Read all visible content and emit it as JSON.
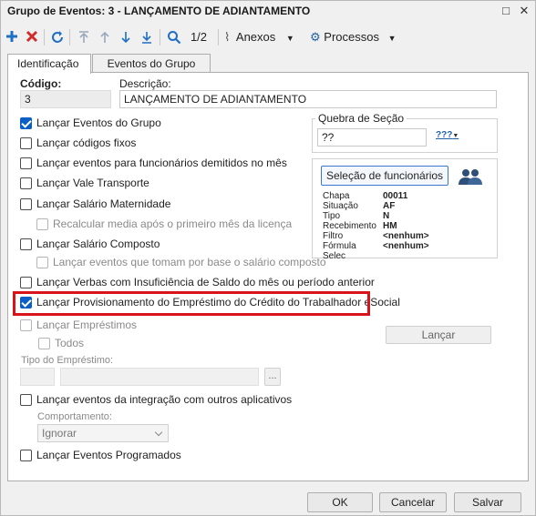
{
  "window": {
    "title": "Grupo de Eventos: 3 - LANÇAMENTO DE ADIANTAMENTO",
    "restore_glyph": "□",
    "close_glyph": "✕"
  },
  "toolbar": {
    "page_indicator": "1/2",
    "anexos_label": "Anexos",
    "processos_label": "Processos",
    "colors": {
      "add": "#1f6fc5",
      "delete": "#d12b2b",
      "refresh": "#1f6fc5",
      "nav": "#1f6fc5",
      "nav_disabled": "#9aa9bd"
    }
  },
  "tabs": [
    {
      "label": "Identificação"
    },
    {
      "label": "Eventos do Grupo"
    }
  ],
  "form": {
    "codigo_label": "Código:",
    "codigo_value": "3",
    "descricao_label": "Descrição:",
    "descricao_value": "LANÇAMENTO DE ADIANTAMENTO",
    "quebra_label": "Quebra de Seção",
    "quebra_value": "??",
    "quebra_picker_text": "???",
    "selecao_button": "Seleção de funcionários",
    "employee_fields": [
      {
        "key": "Chapa",
        "value": "00011"
      },
      {
        "key": "Situação",
        "value": "AF"
      },
      {
        "key": "Tipo",
        "value": "N"
      },
      {
        "key": "Recebimento",
        "value": "HM"
      },
      {
        "key": "Filtro",
        "value": "<nenhum>"
      },
      {
        "key": "Fórmula Selec",
        "value": "<nenhum>"
      }
    ],
    "checkboxes": [
      {
        "label": "Lançar Eventos do Grupo",
        "checked": true
      },
      {
        "label": "Lançar códigos fixos",
        "checked": false
      },
      {
        "label": "Lançar eventos para funcionários demitidos no mês",
        "checked": false
      },
      {
        "label": "Lançar Vale Transporte",
        "checked": false
      },
      {
        "label": "Lançar Salário Maternidade",
        "checked": false
      },
      {
        "label": "Recalcular media após o primeiro mês da licença",
        "checked": false,
        "disabled": true
      },
      {
        "label": "Lançar Salário Composto",
        "checked": false
      },
      {
        "label": "Lançar eventos que tomam por base o salário composto",
        "checked": false,
        "disabled": true
      },
      {
        "label": "Lançar Verbas com Insuficiência de Saldo do mês ou período anterior",
        "checked": false
      },
      {
        "label": "Lançar Provisionamento do Empréstimo do Crédito do Trabalhador eSocial",
        "checked": true
      },
      {
        "label": "Lançar Empréstimos",
        "checked": false,
        "disabled": true
      },
      {
        "label": "Todos",
        "checked": false,
        "disabled": true
      },
      {
        "label": "Lançar eventos da integração com outros aplicativos",
        "checked": false
      },
      {
        "label": "Lançar Eventos Programados",
        "checked": false
      }
    ],
    "lancar_button": "Lançar",
    "tipo_emprestimo_label": "Tipo do Empréstimo:",
    "lookup_button": "...",
    "comportamento_label": "Comportamento:",
    "comportamento_value": "Ignorar"
  },
  "footer": {
    "ok": "OK",
    "cancelar": "Cancelar",
    "salvar": "Salvar"
  },
  "highlight_color": "#d7141a"
}
